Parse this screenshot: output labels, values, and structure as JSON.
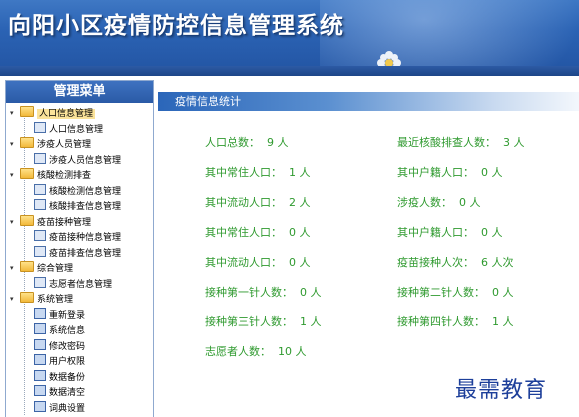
{
  "header": {
    "title": "向阳小区疫情防控信息管理系统"
  },
  "sidebar": {
    "title": "管理菜单",
    "groups": [
      {
        "label": "人口信息管理",
        "children": [
          "人口信息管理"
        ]
      },
      {
        "label": "涉疫人员管理",
        "children": [
          "涉疫人员信息管理"
        ]
      },
      {
        "label": "核酸检测排查",
        "children": [
          "核酸检测信息管理",
          "核酸排查信息管理"
        ]
      },
      {
        "label": "疫苗接种管理",
        "children": [
          "疫苗接种信息管理",
          "疫苗排查信息管理"
        ]
      },
      {
        "label": "综合管理",
        "children": [
          "志愿者信息管理"
        ]
      },
      {
        "label": "系统管理",
        "children": [
          "重新登录",
          "系统信息",
          "修改密码",
          "用户权限",
          "数据备份",
          "数据清空",
          "词典设置"
        ]
      }
    ]
  },
  "main": {
    "panel_title": "疫情信息统计",
    "stats": [
      {
        "label": "人口总数：",
        "value": "9",
        "unit": "人"
      },
      {
        "label": "最近核酸排查人数：",
        "value": "3",
        "unit": "人"
      },
      {
        "label": "其中常住人口：",
        "value": "1",
        "unit": "人"
      },
      {
        "label": "其中户籍人口：",
        "value": "0",
        "unit": "人"
      },
      {
        "label": "其中流动人口：",
        "value": "2",
        "unit": "人"
      },
      {
        "label": "涉疫人数：",
        "value": "0",
        "unit": "人"
      },
      {
        "label": "其中常住人口：",
        "value": "0",
        "unit": "人"
      },
      {
        "label": "其中户籍人口：",
        "value": "0",
        "unit": "人"
      },
      {
        "label": "其中流动人口：",
        "value": "0",
        "unit": "人"
      },
      {
        "label": "疫苗接种人次：",
        "value": "6",
        "unit": "人次"
      },
      {
        "label": "接种第一针人数：",
        "value": "0",
        "unit": "人"
      },
      {
        "label": "接种第二针人数：",
        "value": "0",
        "unit": "人"
      },
      {
        "label": "接种第三针人数：",
        "value": "1",
        "unit": "人"
      },
      {
        "label": "接种第四针人数：",
        "value": "1",
        "unit": "人"
      },
      {
        "label": "志愿者人数：",
        "value": "10",
        "unit": "人"
      }
    ]
  },
  "watermark": "最需教育"
}
